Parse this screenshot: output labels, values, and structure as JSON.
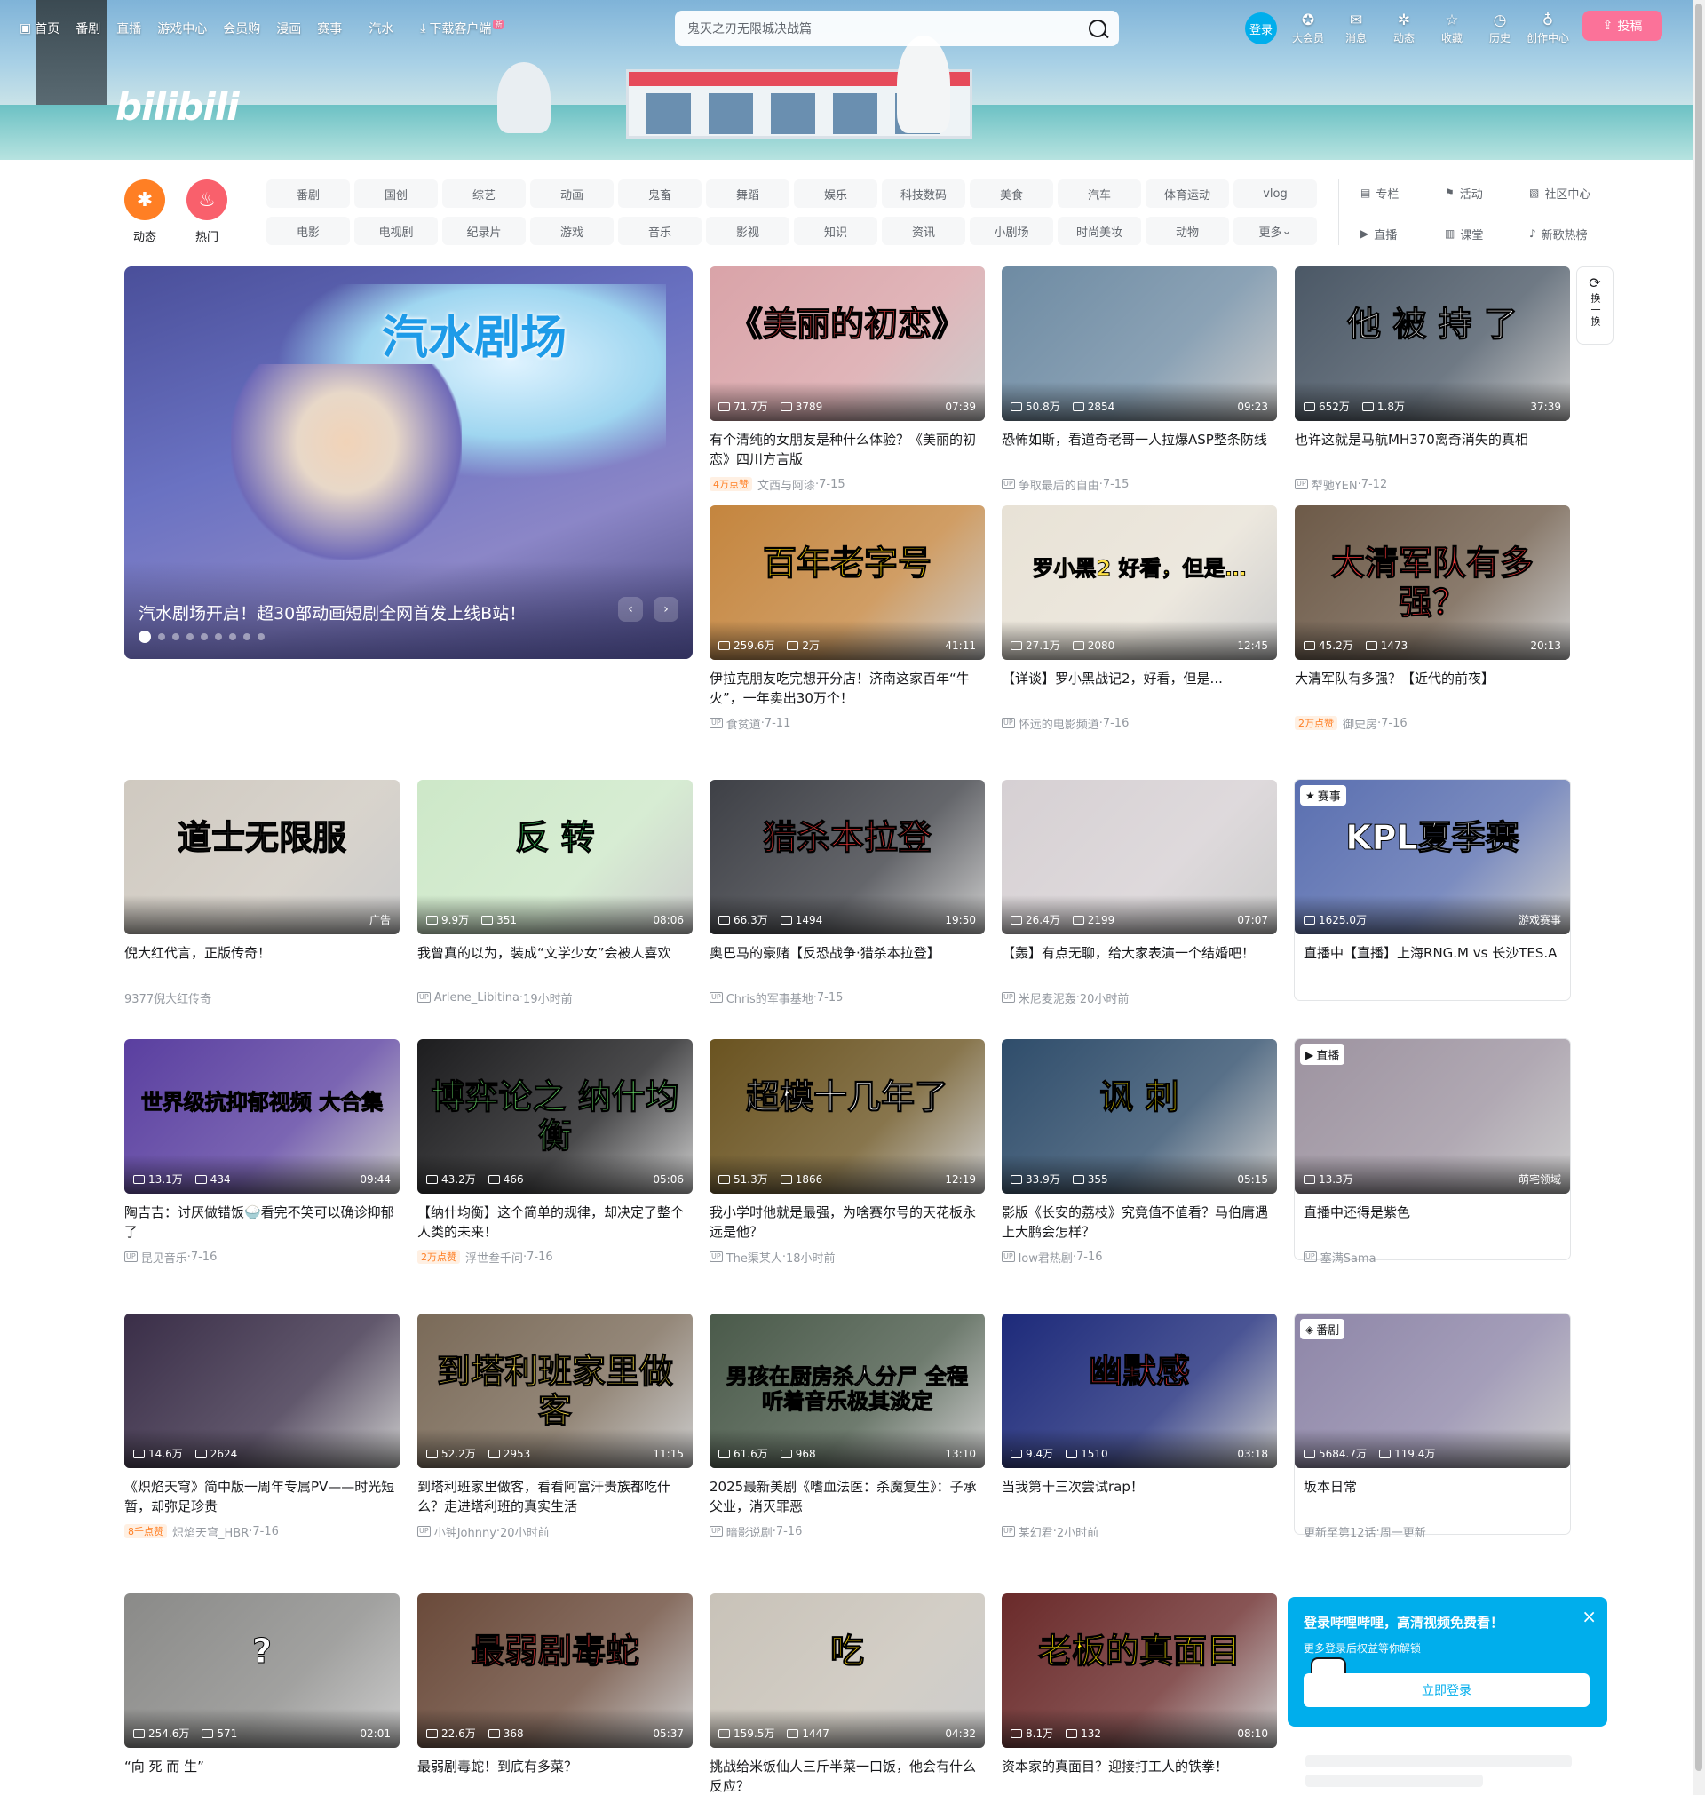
{
  "header": {
    "logo": "bilibili",
    "nav": [
      {
        "icon": "tv-icon",
        "label": "首页"
      },
      {
        "label": "番剧"
      },
      {
        "label": "直播"
      },
      {
        "label": "游戏中心"
      },
      {
        "label": "会员购"
      },
      {
        "label": "漫画"
      },
      {
        "label": "赛事"
      },
      {
        "label": "汽水"
      },
      {
        "icon": "download-icon",
        "label": "下载客户端",
        "badge": "新"
      }
    ],
    "search_placeholder": "鬼灭之刃无限城决战篇",
    "login": "登录",
    "right_nav": [
      {
        "icon": "vip-icon",
        "label": "大会员"
      },
      {
        "icon": "message-icon",
        "label": "消息"
      },
      {
        "icon": "dynamic-icon",
        "label": "动态"
      },
      {
        "icon": "star-icon",
        "label": "收藏"
      },
      {
        "icon": "history-icon",
        "label": "历史"
      },
      {
        "icon": "bulb-icon",
        "label": "创作中心"
      }
    ],
    "upload": "投稿"
  },
  "channels": {
    "big": [
      {
        "label": "动态",
        "color": "#ff7f24"
      },
      {
        "label": "热门",
        "color": "#f9606c"
      }
    ],
    "tags": [
      "番剧",
      "国创",
      "综艺",
      "动画",
      "鬼畜",
      "舞蹈",
      "娱乐",
      "科技数码",
      "美食",
      "汽车",
      "体育运动",
      "vlog",
      "电影",
      "电视剧",
      "纪录片",
      "游戏",
      "音乐",
      "影视",
      "知识",
      "资讯",
      "小剧场",
      "时尚美妆",
      "动物",
      "更多"
    ],
    "side": [
      {
        "icon": "column-icon",
        "label": "专栏"
      },
      {
        "icon": "activity-icon",
        "label": "活动"
      },
      {
        "icon": "community-icon",
        "label": "社区中心"
      },
      {
        "icon": "live-icon",
        "label": "直播"
      },
      {
        "icon": "class-icon",
        "label": "课堂"
      },
      {
        "icon": "music-icon",
        "label": "新歌热榜"
      }
    ]
  },
  "hero": {
    "title_art": "汽水剧场",
    "caption": "汽水剧场开启！超30部动画短剧全网首发上线B站！",
    "prev": "‹",
    "next": "›",
    "dots": 9
  },
  "refresh": {
    "label": "换一换"
  },
  "cards": [
    {
      "art": "《美丽的初恋》",
      "play": "71.7万",
      "dm": "3789",
      "dur": "07:39",
      "title": "有个清纯的女朋友是种什么体验？《美丽的初恋》四川方言版",
      "hot": "4万点赞",
      "author": "文西与阿漆",
      "date": "7-15",
      "bg": "#d9a3a8"
    },
    {
      "art": "",
      "play": "50.8万",
      "dm": "2854",
      "dur": "09:23",
      "title": "恐怖如斯，看道奇老哥一人拉爆ASP整条防线",
      "author": "争取最后的自由",
      "date": "7-15",
      "bg": "#6e8ba3"
    },
    {
      "art": "他 被 持 了",
      "play": "652万",
      "dm": "1.8万",
      "dur": "37:39",
      "title": "也许这就是马航MH370离奇消失的真相",
      "author": "犁驰YEN",
      "date": "7-12",
      "bg": "#4b5866"
    },
    {
      "art": "百年老字号",
      "play": "259.6万",
      "dm": "2万",
      "dur": "41:11",
      "title": "伊拉克朋友吃完想开分店！济南这家百年“牛火”，一年卖出30万个！",
      "author": "食贫道",
      "date": "7-11",
      "bg": "#c4853e"
    },
    {
      "art": "罗小黑2 好看，但是…",
      "play": "27.1万",
      "dm": "2080",
      "dur": "12:45",
      "title": "【详谈】罗小黑战记2，好看，但是...",
      "author": "怀远的电影频道",
      "date": "7-16",
      "bg": "#e8e2d6"
    },
    {
      "art": "大清军队有多强？",
      "play": "45.2万",
      "dm": "1473",
      "dur": "20:13",
      "title": "大清军队有多强？【近代的前夜】",
      "hot": "2万点赞",
      "author": "御史房",
      "date": "7-16",
      "bg": "#6d5a48"
    },
    {
      "art": "道士无限服",
      "play": "",
      "dm": "",
      "dur": "广告",
      "title": "倪大红代言，正版传奇！",
      "author": "9377倪大红传奇",
      "date": "",
      "bg": "#cfc9c0",
      "ad": true
    },
    {
      "art": "反 转",
      "play": "9.9万",
      "dm": "351",
      "dur": "08:06",
      "title": "我曾真的以为，装成“文学少女”会被人喜欢",
      "author": "Arlene_Libitina",
      "date": "19小时前",
      "bg": "#cde8c8"
    },
    {
      "art": "猎杀本拉登",
      "play": "66.3万",
      "dm": "1494",
      "dur": "19:50",
      "title": "奥巴马的豪赌【反恐战争·猎杀本拉登】",
      "author": "Chris的军事基地",
      "date": "7-15",
      "bg": "#3e4046"
    },
    {
      "art": "",
      "play": "26.4万",
      "dm": "2199",
      "dur": "07:07",
      "title": "【轰】有点无聊，给大家表演一个结婚吧！",
      "author": "米尼麦泥轰",
      "date": "20小时前",
      "bg": "#d6d0d3"
    },
    {
      "art": "KPL夏季赛",
      "play": "1625.0万",
      "dm": "",
      "dur": "游戏赛事",
      "title": "【直播】上海RNG.M vs 长沙TES.A",
      "badge": "赛事",
      "live": "直播中",
      "author": "",
      "date": "",
      "bg": "#5a6fb0",
      "special": true
    },
    {
      "art": "世界级抗抑郁视频 大合集",
      "play": "13.1万",
      "dm": "434",
      "dur": "09:44",
      "title": "陶吉吉：讨厌做错饭🍚看完不笑可以确诊抑郁了",
      "author": "昆见音乐",
      "date": "7-16",
      "bg": "#5a3fa0"
    },
    {
      "art": "博弈论之 纳什均衡",
      "play": "43.2万",
      "dm": "466",
      "dur": "05:06",
      "title": "【纳什均衡】这个简单的规律，却决定了整个人类的未来！",
      "hot": "2万点赞",
      "author": "浮世叁千问",
      "date": "7-16",
      "bg": "#1d1d1f"
    },
    {
      "art": "超模十几年了",
      "play": "51.3万",
      "dm": "1866",
      "dur": "12:19",
      "title": "我小学时他就是最强，为啥赛尔号的天花板永远是他？",
      "author": "The渠某人",
      "date": "18小时前",
      "bg": "#6a5320"
    },
    {
      "art": "讽 刺",
      "play": "33.9万",
      "dm": "355",
      "dur": "05:15",
      "title": "影版《长安的荔枝》究竟值不值看？马伯庸遇上大鹏会怎样？",
      "author": "low君热剧",
      "date": "7-16",
      "bg": "#2f4d6b"
    },
    {
      "art": "",
      "play": "13.3万",
      "dm": "",
      "dur": "萌宅领域",
      "title": "还得是紫色",
      "badge": "直播",
      "live": "直播中",
      "author": "塞满Sama",
      "date": "",
      "bg": "#9d93a0",
      "special": true,
      "viewer": true
    },
    {
      "art": "",
      "play": "14.6万",
      "dm": "2624",
      "dur": "",
      "title": "《炽焰天穹》简中版一周年专属PV——时光短暂，却弥足珍贵",
      "hot": "8千点赞",
      "author": "炽焰天穹_HBR",
      "date": "7-16",
      "bg": "#3a2e48"
    },
    {
      "art": "到塔利班家里做客",
      "play": "52.2万",
      "dm": "2953",
      "dur": "11:15",
      "title": "到塔利班家里做客，看看阿富汗贵族都吃什么？走进塔利班的真实生活",
      "author": "小钟Johnny",
      "date": "20小时前",
      "bg": "#7a6a58"
    },
    {
      "art": "男孩在厨房杀人分尸 全程听着音乐极其淡定",
      "play": "61.6万",
      "dm": "968",
      "dur": "13:10",
      "title": "2025最新美剧《嗜血法医：杀魔复生》：子承父业，消灭罪恶",
      "author": "暗影说剧",
      "date": "7-16",
      "bg": "#4a5a4a"
    },
    {
      "art": "幽默感",
      "play": "9.4万",
      "dm": "1510",
      "dur": "03:18",
      "title": "当我第十三次尝试rap！",
      "author": "某幻君",
      "date": "2小时前",
      "bg": "#1d2a7a"
    },
    {
      "art": "",
      "play": "5684.7万",
      "dm": "119.4万",
      "dur": "",
      "title": "坂本日常",
      "badge": "番剧",
      "author": "更新至第12话",
      "date": "周一更新",
      "bg": "#8e86a8",
      "special": true,
      "fav": true
    },
    {
      "art": "?",
      "play": "254.6万",
      "dm": "571",
      "dur": "02:01",
      "title": "“向 死 而 生”",
      "author": "",
      "date": "",
      "bg": "#8a8a88"
    },
    {
      "art": "最弱剧毒蛇",
      "play": "22.6万",
      "dm": "368",
      "dur": "05:37",
      "title": "最弱剧毒蛇！到底有多菜？",
      "author": "",
      "date": "",
      "bg": "#6a4a3a"
    },
    {
      "art": "吃",
      "play": "159.5万",
      "dm": "1447",
      "dur": "04:32",
      "title": "挑战给米饭仙人三斤半菜一口饭，他会有什么反应？",
      "author": "",
      "date": "",
      "bg": "#c8c2b8"
    },
    {
      "art": "老板的真面目",
      "play": "8.1万",
      "dm": "132",
      "dur": "08:10",
      "title": "资本家的真面目？迎接打工人的铁拳！",
      "author": "",
      "date": "",
      "bg": "#6a2a2a"
    }
  ],
  "popup": {
    "title": "登录哔哩哔哩，高清视频免费看！",
    "sub": "更多登录后权益等你解锁",
    "button": "立即登录",
    "close": "×"
  },
  "colors": {
    "accent": "#00aeec",
    "pink": "#fb7299"
  }
}
